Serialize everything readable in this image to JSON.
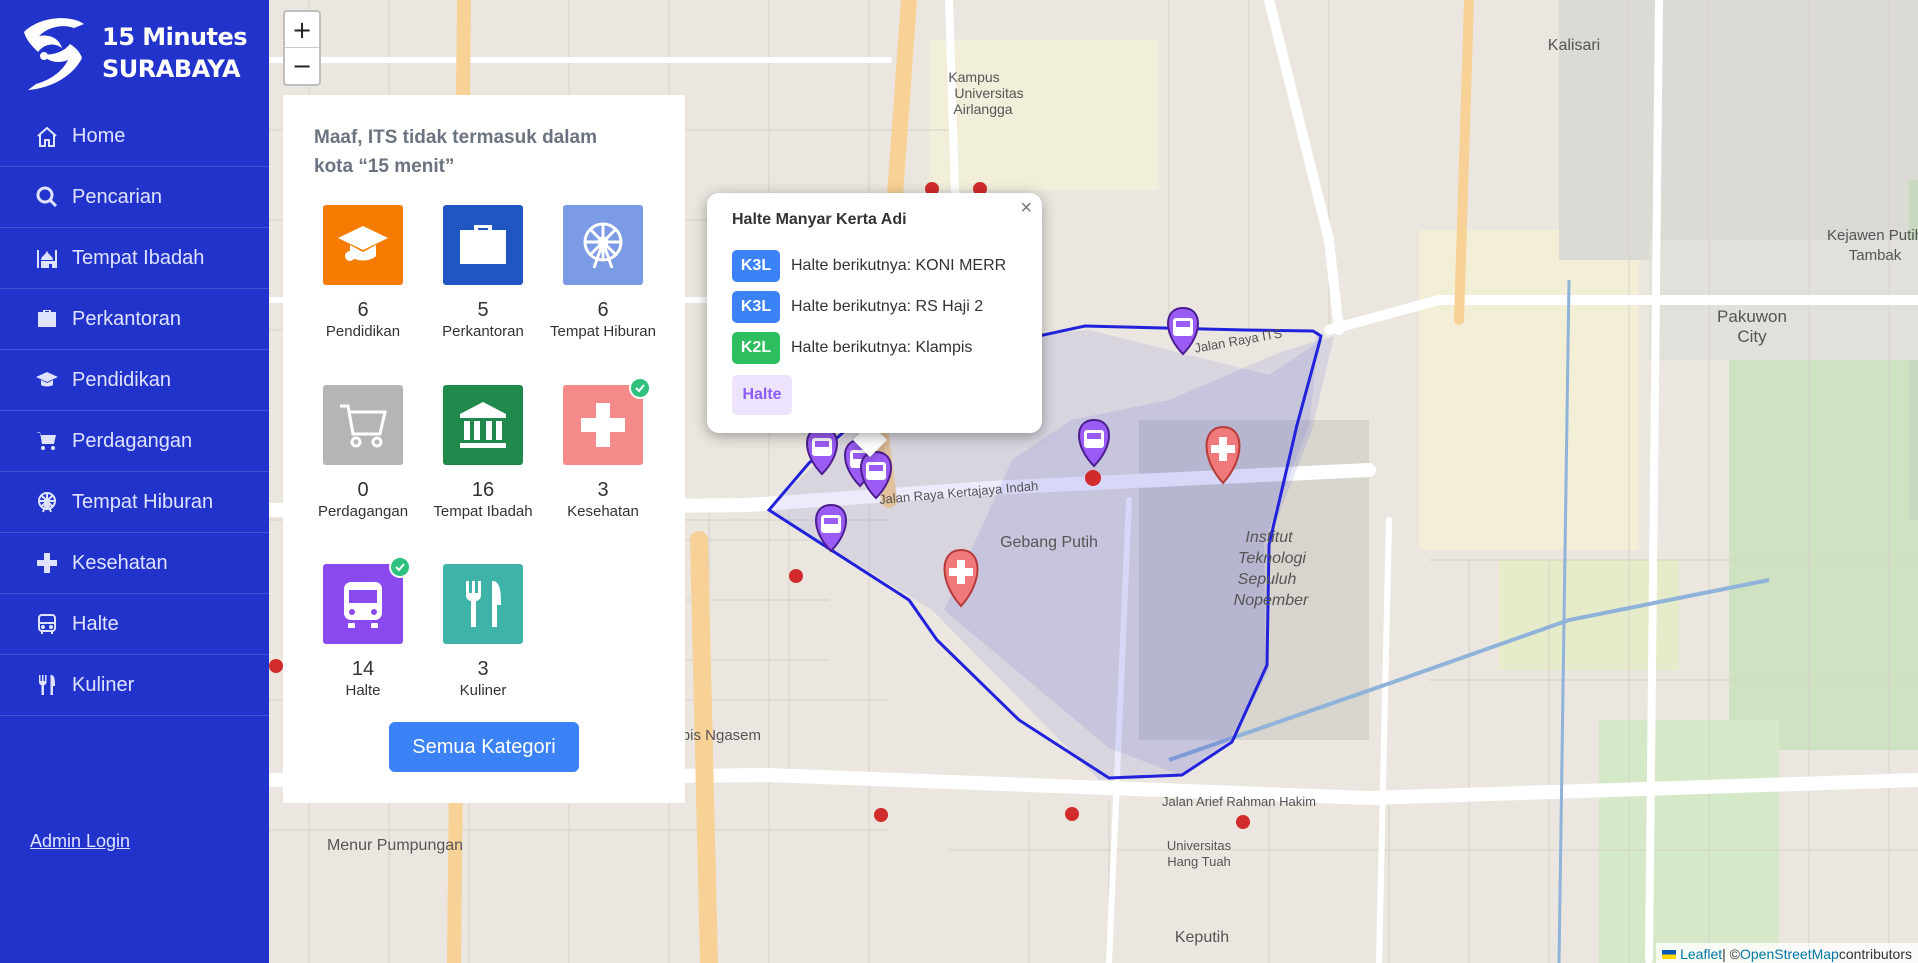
{
  "app": {
    "title_line1": "15 Minutes",
    "title_line2": "SURABAYA"
  },
  "sidebar": {
    "items": [
      {
        "label": "Home",
        "icon": "home-icon"
      },
      {
        "label": "Pencarian",
        "icon": "search-icon"
      },
      {
        "label": "Tempat Ibadah",
        "icon": "mosque-icon"
      },
      {
        "label": "Perkantoran",
        "icon": "briefcase-icon"
      },
      {
        "label": "Pendidikan",
        "icon": "graduation-cap-icon"
      },
      {
        "label": "Perdagangan",
        "icon": "cart-icon"
      },
      {
        "label": "Tempat Hiburan",
        "icon": "ferris-wheel-icon"
      },
      {
        "label": "Kesehatan",
        "icon": "plus-icon"
      },
      {
        "label": "Halte",
        "icon": "bus-icon"
      },
      {
        "label": "Kuliner",
        "icon": "utensils-icon"
      }
    ],
    "admin_login": "Admin Login"
  },
  "map": {
    "zoom_in": "+",
    "zoom_out": "−",
    "attribution_leaflet": "Leaflet",
    "attribution_sep": " | © ",
    "attribution_osm": "OpenStreetMap",
    "attribution_suffix": " contributors",
    "labels": {
      "kampus": "Kampus",
      "universitas": "Universitas",
      "airlangga": "Airlangga",
      "its1": "Institut",
      "its2": "Teknologi",
      "its3": "Sepuluh",
      "its4": "Nopember",
      "pakuwon1": "Pakuwon",
      "pakuwon2": "City",
      "gebang": "Gebang Putih",
      "keputih": "Keputih",
      "menur": "Menur Pumpungan",
      "kejawen1": "Kejawen Putih",
      "kejawen2": "Tambak",
      "kalisari": "Kalisari",
      "kertajaya": "Jalan Raya Kertajaya Indah",
      "arif": "Jalan Arief Rahman Hakim",
      "klampis": "ampis Ngasem",
      "raya_its": "Jalan Raya ITS",
      "hang_tuah1": "Universitas",
      "hang_tuah2": "Hang Tuah"
    }
  },
  "panel": {
    "title": "Maaf, ITS tidak termasuk dalam kota “15 menit”",
    "categories": [
      {
        "count": "6",
        "label": "Pendidikan",
        "color": "#f57c00",
        "icon": "graduation-cap-icon",
        "checked": false
      },
      {
        "count": "5",
        "label": "Perkantoran",
        "color": "#1f56c2",
        "icon": "briefcase-icon",
        "checked": false
      },
      {
        "count": "6",
        "label": "Tempat Hiburan",
        "color": "#7b9be6",
        "icon": "ferris-wheel-icon",
        "checked": false
      },
      {
        "count": "0",
        "label": "Perdagangan",
        "color": "#b5b5b5",
        "icon": "cart-icon",
        "checked": false
      },
      {
        "count": "16",
        "label": "Tempat Ibadah",
        "color": "#1f8a4c",
        "icon": "bank-icon",
        "checked": false
      },
      {
        "count": "3",
        "label": "Kesehatan",
        "color": "#f48a8a",
        "icon": "plus-icon",
        "checked": true
      },
      {
        "count": "14",
        "label": "Halte",
        "color": "#8a4af0",
        "icon": "bus-icon",
        "checked": true
      },
      {
        "count": "3",
        "label": "Kuliner",
        "color": "#3fb3a8",
        "icon": "utensils-icon",
        "checked": false
      }
    ],
    "all_button": "Semua Kategori"
  },
  "popup": {
    "title": "Halte Manyar Kerta Adi",
    "close": "×",
    "routes": [
      {
        "code": "K3L",
        "text": "Halte berikutnya: KONI MERR",
        "color": "#3b82f6"
      },
      {
        "code": "K3L",
        "text": "Halte berikutnya: RS Haji 2",
        "color": "#3b82f6"
      },
      {
        "code": "K2L",
        "text": "Halte berikutnya: Klampis",
        "color": "#2ebd5f"
      }
    ],
    "badge": "Halte"
  }
}
